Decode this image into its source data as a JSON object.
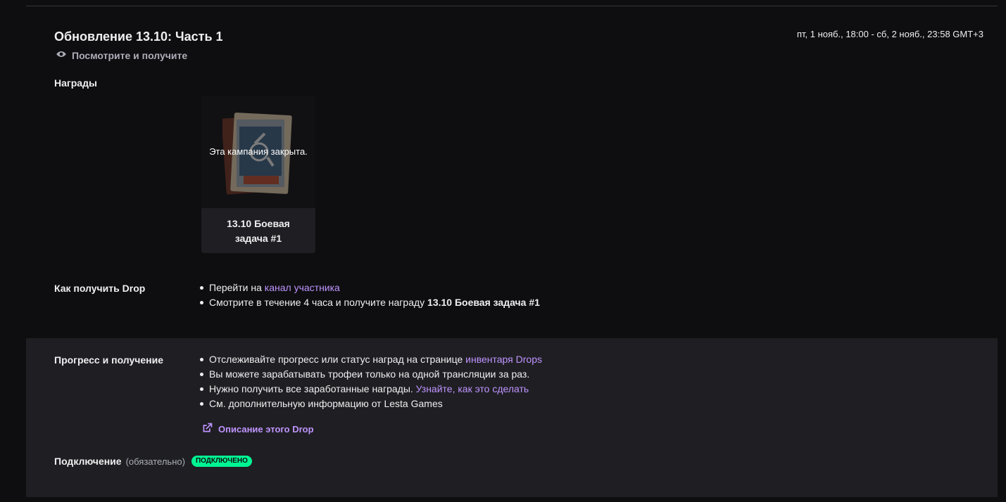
{
  "campaign": {
    "title": "Обновление 13.10: Часть 1",
    "subtitle": "Посмотрите и получите",
    "date_range": "пт, 1 нояб., 18:00 - сб, 2 нояб., 23:58 GMT+3"
  },
  "rewards": {
    "label": "Награды",
    "card": {
      "status": "Эта кампания закрыта.",
      "name": "13.10 Боевая задача #1"
    }
  },
  "how_to": {
    "label": "Как получить Drop",
    "step1_text": "Перейти на ",
    "step1_link": "канал участника",
    "step2_text": "Смотрите в течение 4 часа и получите награду ",
    "step2_reward": "13.10 Боевая задача #1"
  },
  "progress": {
    "label": "Прогресс и получение",
    "item1_text": "Отслеживайте прогресс или статус наград на странице ",
    "item1_link": "инвентаря Drops",
    "item2_text": "Вы можете зарабатывать трофеи только на одной трансляции за раз.",
    "item3_text": "Нужно получить все заработанные награды. ",
    "item3_link": "Узнайте, как это сделать",
    "item4_text": "См. дополнительную информацию от Lesta Games",
    "description_link": "Описание этого Drop"
  },
  "connection": {
    "label": "Подключение",
    "optional": "(обязательно)",
    "badge": "ПОДКЛЮЧЕНО",
    "badge_color": "#00f593"
  },
  "icons": {
    "subtitle_icon": "eye-icon",
    "description_icon": "external-link-icon"
  }
}
